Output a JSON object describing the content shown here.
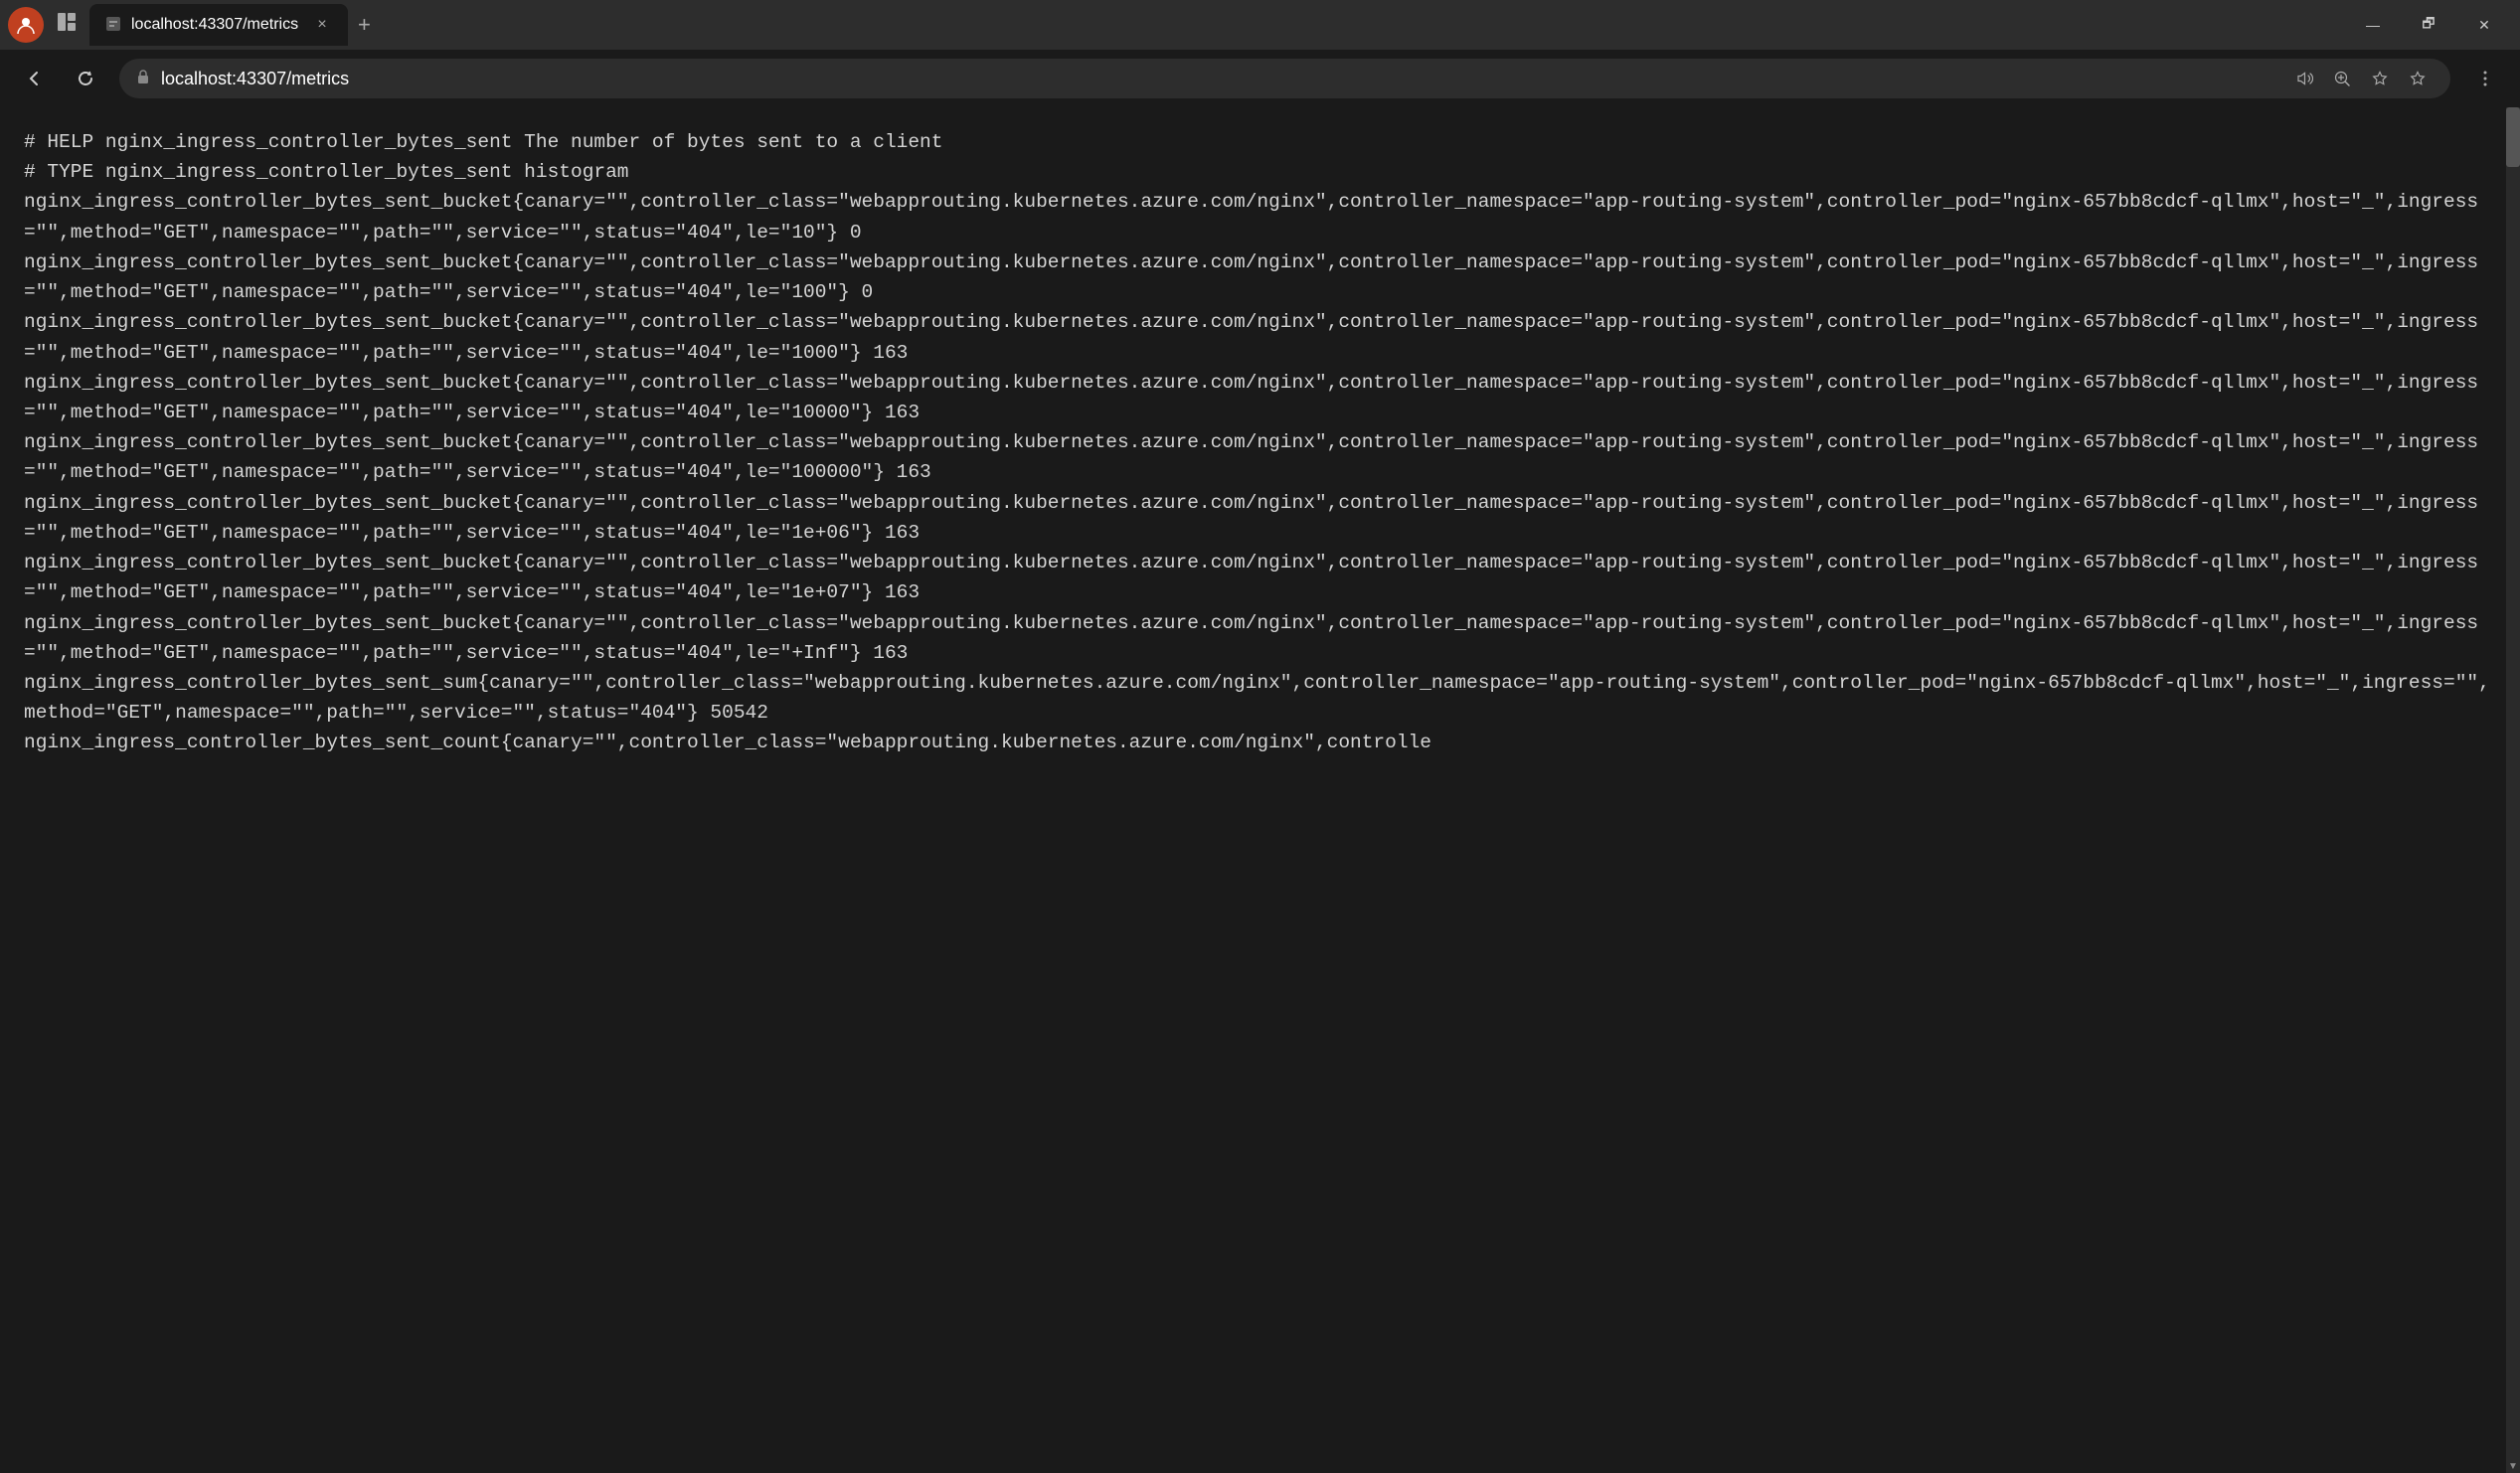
{
  "titlebar": {
    "profile_initial": "👤",
    "tab_url": "localhost:43307/metrics",
    "tab_close_label": "×",
    "tab_new_label": "+",
    "win_minimize": "—",
    "win_restore": "🗗",
    "win_close": "✕"
  },
  "addressbar": {
    "back_label": "←",
    "forward_label": "→",
    "refresh_label": "↻",
    "url": "localhost:43307/metrics",
    "read_aloud_title": "Read aloud",
    "zoom_title": "Zoom",
    "favorites_title": "Add to favorites",
    "favorites_bar_title": "Favorites",
    "more_title": "Settings and more"
  },
  "content": {
    "metrics_text": "# HELP nginx_ingress_controller_bytes_sent The number of bytes sent to a client\n# TYPE nginx_ingress_controller_bytes_sent histogram\nnginx_ingress_controller_bytes_sent_bucket{canary=\"\",controller_class=\"webapprouting.kubernetes.azure.com/nginx\",controller_namespace=\"app-routing-system\",controller_pod=\"nginx-657bb8cdcf-qllmx\",host=\"_\",ingress=\"\",method=\"GET\",namespace=\"\",path=\"\",service=\"\",status=\"404\",le=\"10\"} 0\nnginx_ingress_controller_bytes_sent_bucket{canary=\"\",controller_class=\"webapprouting.kubernetes.azure.com/nginx\",controller_namespace=\"app-routing-system\",controller_pod=\"nginx-657bb8cdcf-qllmx\",host=\"_\",ingress=\"\",method=\"GET\",namespace=\"\",path=\"\",service=\"\",status=\"404\",le=\"100\"} 0\nnginx_ingress_controller_bytes_sent_bucket{canary=\"\",controller_class=\"webapprouting.kubernetes.azure.com/nginx\",controller_namespace=\"app-routing-system\",controller_pod=\"nginx-657bb8cdcf-qllmx\",host=\"_\",ingress=\"\",method=\"GET\",namespace=\"\",path=\"\",service=\"\",status=\"404\",le=\"1000\"} 163\nnginx_ingress_controller_bytes_sent_bucket{canary=\"\",controller_class=\"webapprouting.kubernetes.azure.com/nginx\",controller_namespace=\"app-routing-system\",controller_pod=\"nginx-657bb8cdcf-qllmx\",host=\"_\",ingress=\"\",method=\"GET\",namespace=\"\",path=\"\",service=\"\",status=\"404\",le=\"10000\"} 163\nnginx_ingress_controller_bytes_sent_bucket{canary=\"\",controller_class=\"webapprouting.kubernetes.azure.com/nginx\",controller_namespace=\"app-routing-system\",controller_pod=\"nginx-657bb8cdcf-qllmx\",host=\"_\",ingress=\"\",method=\"GET\",namespace=\"\",path=\"\",service=\"\",status=\"404\",le=\"100000\"} 163\nnginx_ingress_controller_bytes_sent_bucket{canary=\"\",controller_class=\"webapprouting.kubernetes.azure.com/nginx\",controller_namespace=\"app-routing-system\",controller_pod=\"nginx-657bb8cdcf-qllmx\",host=\"_\",ingress=\"\",method=\"GET\",namespace=\"\",path=\"\",service=\"\",status=\"404\",le=\"1e+06\"} 163\nnginx_ingress_controller_bytes_sent_bucket{canary=\"\",controller_class=\"webapprouting.kubernetes.azure.com/nginx\",controller_namespace=\"app-routing-system\",controller_pod=\"nginx-657bb8cdcf-qllmx\",host=\"_\",ingress=\"\",method=\"GET\",namespace=\"\",path=\"\",service=\"\",status=\"404\",le=\"1e+07\"} 163\nnginx_ingress_controller_bytes_sent_bucket{canary=\"\",controller_class=\"webapprouting.kubernetes.azure.com/nginx\",controller_namespace=\"app-routing-system\",controller_pod=\"nginx-657bb8cdcf-qllmx\",host=\"_\",ingress=\"\",method=\"GET\",namespace=\"\",path=\"\",service=\"\",status=\"404\",le=\"+Inf\"} 163\nnginx_ingress_controller_bytes_sent_sum{canary=\"\",controller_class=\"webapprouting.kubernetes.azure.com/nginx\",controller_namespace=\"app-routing-system\",controller_pod=\"nginx-657bb8cdcf-qllmx\",host=\"_\",ingress=\"\",method=\"GET\",namespace=\"\",path=\"\",service=\"\",status=\"404\"} 50542\nnginx_ingress_controller_bytes_sent_count{canary=\"\",controller_class=\"webapprouting.kubernetes.azure.com/nginx\",controlle"
  }
}
